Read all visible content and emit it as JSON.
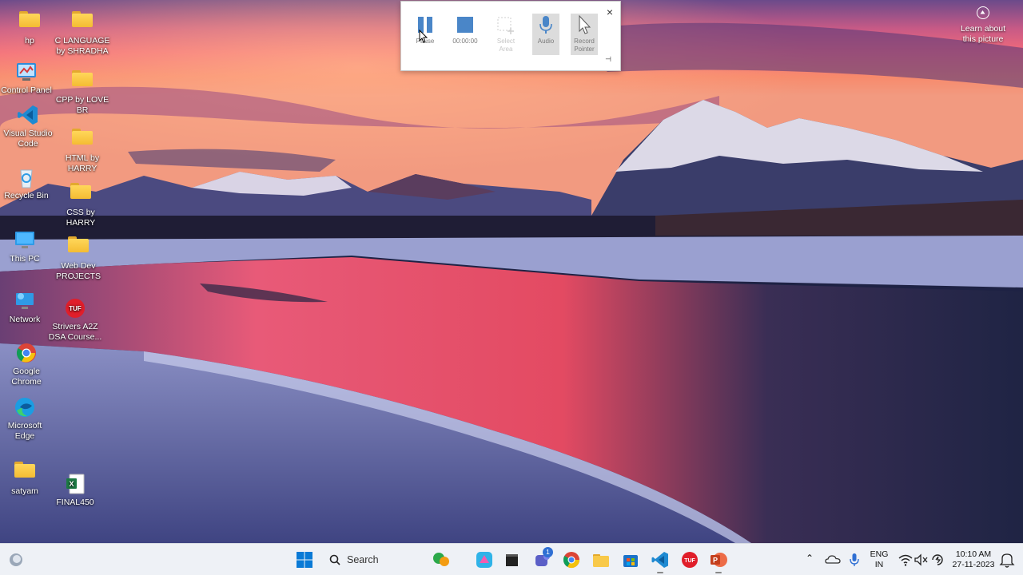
{
  "desktop": {
    "icons": [
      {
        "label": "hp",
        "icon": "folder-icon"
      },
      {
        "label": "C LANGUAGE by SHRADHA",
        "icon": "folder-icon"
      },
      {
        "label": "Control Panel",
        "icon": "control-panel-icon"
      },
      {
        "label": "CPP by LOVE BR",
        "icon": "folder-icon"
      },
      {
        "label": "Visual Studio Code",
        "icon": "vscode-icon"
      },
      {
        "label": "HTML by HARRY",
        "icon": "chrome-folder-icon"
      },
      {
        "label": "Recycle Bin",
        "icon": "recycle-bin-icon"
      },
      {
        "label": "CSS by HARRY",
        "icon": "chrome-folder-icon"
      },
      {
        "label": "This PC",
        "icon": "monitor-icon"
      },
      {
        "label": "Web Dev PROJECTS",
        "icon": "folder-icon"
      },
      {
        "label": "Network",
        "icon": "network-icon"
      },
      {
        "label": "Strivers A2Z DSA Course...",
        "icon": "tuf-icon"
      },
      {
        "label": "Google Chrome",
        "icon": "chrome-icon"
      },
      {
        "label": "Microsoft Edge",
        "icon": "edge-icon"
      },
      {
        "label": "satyam",
        "icon": "folder-icon"
      },
      {
        "label": "FINAL450",
        "icon": "excel-icon"
      }
    ]
  },
  "recorder": {
    "pause_label": "Pause",
    "timer": "00:00:00",
    "select_area_label": "Select Area",
    "audio_label": "Audio",
    "record_pointer_label": "Record Pointer",
    "close_symbol": "×",
    "pin_symbol": "⊣",
    "accent_color": "#4a86c8"
  },
  "learn_about": {
    "text": "Learn about this picture"
  },
  "taskbar": {
    "search_label": "Search",
    "teams_badge": "1",
    "language_line1": "ENG",
    "language_line2": "IN",
    "time": "10:10 AM",
    "date": "27-11-2023",
    "apps": [
      "weather-icon",
      "start-icon",
      "search-icon",
      "widgets-icon",
      "copilot-icon",
      "terminal-icon",
      "teams-icon",
      "chrome-icon",
      "file-explorer-icon",
      "store-icon",
      "vscode-icon",
      "tuf-icon",
      "powerpoint-icon"
    ]
  }
}
